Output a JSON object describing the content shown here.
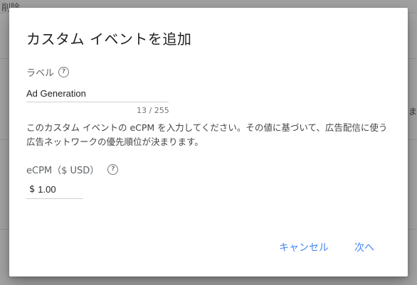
{
  "background": {
    "breadcrumb": "削除",
    "right_fragment": "ま"
  },
  "dialog": {
    "title": "カスタム イベントを追加",
    "label_field": {
      "label": "ラベル",
      "value": "Ad Generation",
      "counter": "13 / 255"
    },
    "description": "このカスタム イベントの eCPM を入力してください。その値に基づいて、広告配信に使う広告ネットワークの優先順位が決まります。",
    "ecpm_field": {
      "label": "eCPM（$ USD）",
      "currency": "$",
      "value": "1.00"
    },
    "buttons": {
      "cancel": "キャンセル",
      "next": "次へ"
    }
  },
  "icons": {
    "help": "help-circle-icon"
  },
  "colors": {
    "accent": "#4285f4",
    "scrim": "rgba(0,0,0,0.33)"
  }
}
